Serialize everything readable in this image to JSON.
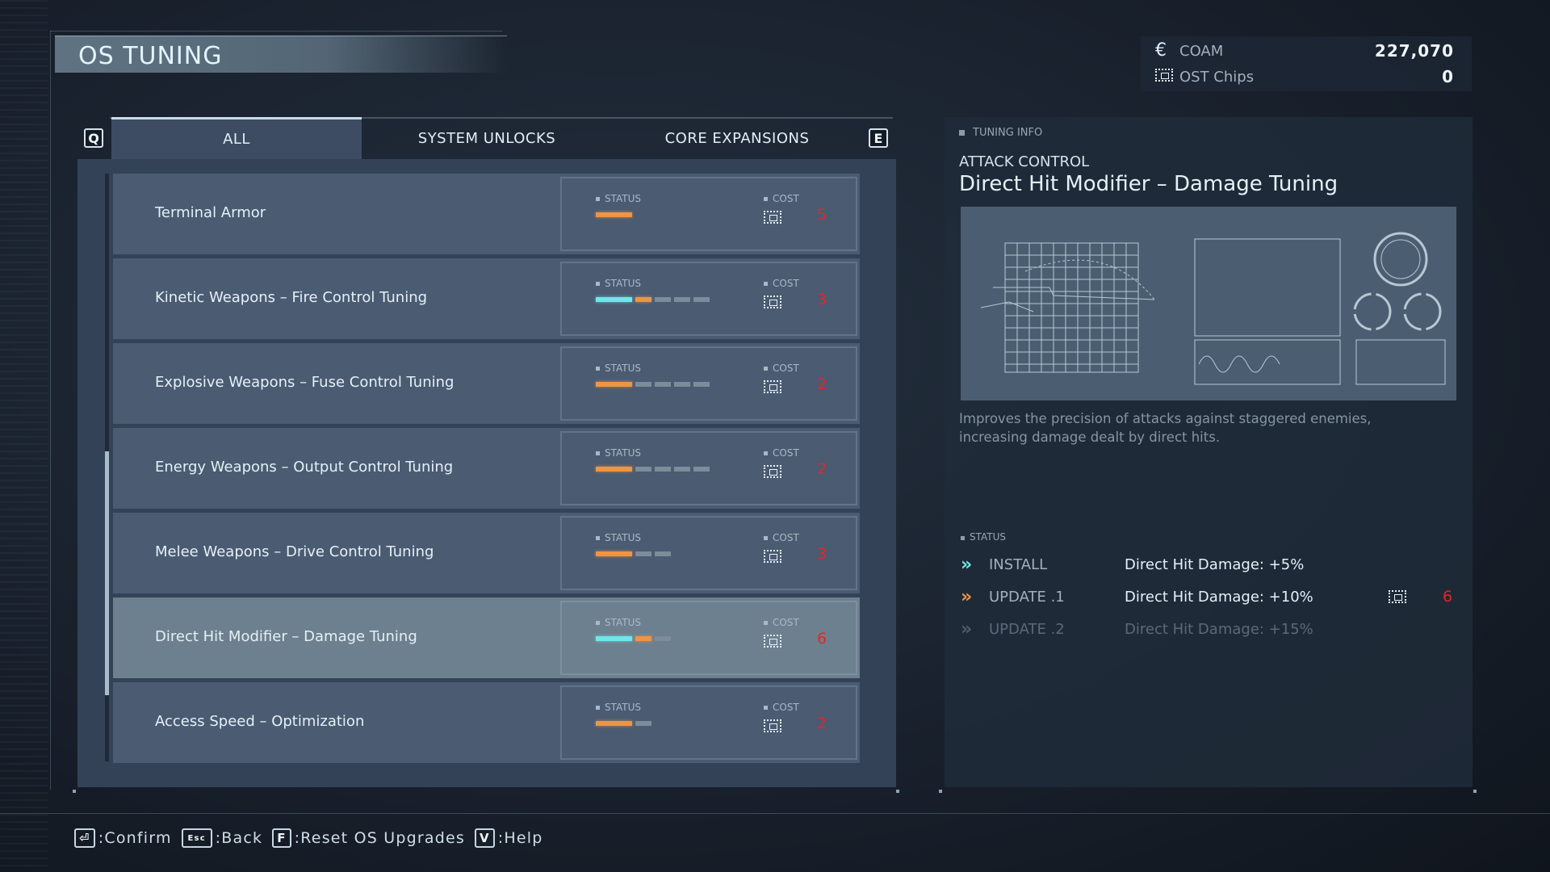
{
  "header": {
    "title": "OS TUNING"
  },
  "currency": {
    "coam": {
      "icon": "coam-icon",
      "label": "COAM",
      "value": "227,070"
    },
    "ost": {
      "icon": "ost-chip-icon",
      "label": "OST Chips",
      "value": "0"
    }
  },
  "tabs": {
    "prev_key": "Q",
    "next_key": "E",
    "items": [
      {
        "label": "ALL",
        "active": true
      },
      {
        "label": "SYSTEM UNLOCKS",
        "active": false
      },
      {
        "label": "CORE EXPANSIONS",
        "active": false
      }
    ]
  },
  "list": {
    "status_label": "STATUS",
    "cost_label": "COST",
    "items": [
      {
        "name": "Terminal Armor",
        "bars": [
          "o"
        ],
        "cost": "5",
        "selected": false
      },
      {
        "name": "Kinetic Weapons – Fire Control Tuning",
        "bars": [
          "c",
          "o",
          "g",
          "g",
          "g"
        ],
        "cost": "3",
        "selected": false
      },
      {
        "name": "Explosive Weapons – Fuse Control Tuning",
        "bars": [
          "o",
          "g",
          "g",
          "g",
          "g"
        ],
        "cost": "2",
        "selected": false
      },
      {
        "name": "Energy Weapons – Output Control Tuning",
        "bars": [
          "o",
          "g",
          "g",
          "g",
          "g"
        ],
        "cost": "2",
        "selected": false
      },
      {
        "name": "Melee Weapons – Drive Control Tuning",
        "bars": [
          "o",
          "g",
          "g"
        ],
        "cost": "3",
        "selected": false
      },
      {
        "name": "Direct Hit Modifier – Damage Tuning",
        "bars": [
          "c",
          "o",
          "g"
        ],
        "cost": "6",
        "selected": true
      },
      {
        "name": "Access Speed – Optimization",
        "bars": [
          "o",
          "g"
        ],
        "cost": "2",
        "selected": false
      }
    ]
  },
  "info": {
    "section_label": "TUNING INFO",
    "category": "ATTACK CONTROL",
    "title": "Direct Hit Modifier – Damage Tuning",
    "description": "Improves the precision of attacks against staggered enemies, increasing damage dealt by direct hits.",
    "status_label": "STATUS",
    "levels": [
      {
        "level": "INSTALL",
        "effect": "Direct Hit Damage: +5%",
        "arrow_color": "#6fe6ea",
        "state": "installed"
      },
      {
        "level": "UPDATE .1",
        "effect": "Direct Hit Damage: +10%",
        "arrow_color": "#ef9443",
        "state": "next",
        "cost": "6"
      },
      {
        "level": "UPDATE .2",
        "effect": "Direct Hit Damage: +15%",
        "arrow_color": "#4e5d6b",
        "state": "locked"
      }
    ]
  },
  "footer": [
    {
      "key": "⏎",
      "label": ":Confirm"
    },
    {
      "key": "Esc",
      "label": ":Back"
    },
    {
      "key": "F",
      "label": ":Reset OS Upgrades"
    },
    {
      "key": "V",
      "label": ":Help"
    }
  ],
  "colors": {
    "installed": "#6fe6ea",
    "pending": "#ef9443",
    "cost": "#e02828"
  }
}
